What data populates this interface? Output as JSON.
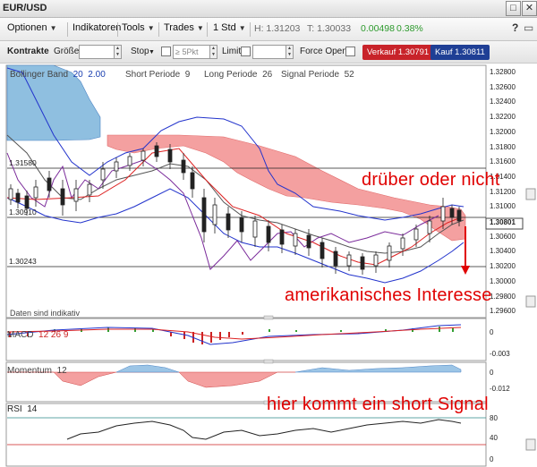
{
  "window": {
    "title": "EUR/USD",
    "restore_icon": "restore-icon",
    "close_icon": "close-icon"
  },
  "menubar": {
    "optionen": "Optionen",
    "indikatoren": "Indikatoren",
    "tools": "Tools",
    "trades": "Trades",
    "interval": "1 Std",
    "high": "H: 1.31203",
    "tief": "T: 1.30033",
    "change": "0.00498",
    "change_pct": "0.38%",
    "help_icon": "help-icon",
    "detach_icon": "detach-icon"
  },
  "orderbar": {
    "kontrakte": "Kontrakte",
    "groesse": "Größe",
    "stop": "Stop",
    "stop_placeholder": "≥ 5Pkt",
    "limit": "Limit",
    "force_open": "Force Open",
    "verkauf": "Verkauf 1.30791",
    "kauf": "Kauf 1.30811"
  },
  "chart": {
    "bollinger_label": "Bollinger Band",
    "bollinger_a": "20",
    "bollinger_b": "2.00",
    "short_label": "Short Periode",
    "short_val": "9",
    "long_label": "Long Periode",
    "long_val": "26",
    "signal_label": "Signal Periode",
    "signal_val": "52",
    "price_axis": [
      "1.32800",
      "1.32600",
      "1.32400",
      "1.32200",
      "1.32000",
      "1.31800",
      "1.31600",
      "1.31400",
      "1.31200",
      "1.31000",
      "1.30801",
      "1.30600",
      "1.30400",
      "1.30200",
      "1.30000",
      "1.29800",
      "1.29600"
    ],
    "levels": [
      "1.31580",
      "1.30910",
      "1.30243"
    ],
    "current_price": "1.30801",
    "footer_note": "Daten sind indikativ"
  },
  "macd": {
    "title": "MACD",
    "params": "12  26  9",
    "axis": [
      "0",
      "-0.003"
    ]
  },
  "momentum": {
    "title": "Momentum",
    "param": "12",
    "axis": [
      "0",
      "-0.012"
    ]
  },
  "rsi": {
    "title": "RSI",
    "param": "14",
    "axis": [
      "80",
      "40",
      "0"
    ]
  },
  "annotations": {
    "a1": "drüber oder nicht",
    "a2": "amerikanisches Interesse",
    "a3": "hier kommt ein short Signal"
  },
  "colors": {
    "cloud_red": "#f4a0a0",
    "cloud_blue": "#8fbfe0",
    "annotation": "#e00000",
    "sell": "#c8232a",
    "buy": "#1f3f95"
  }
}
